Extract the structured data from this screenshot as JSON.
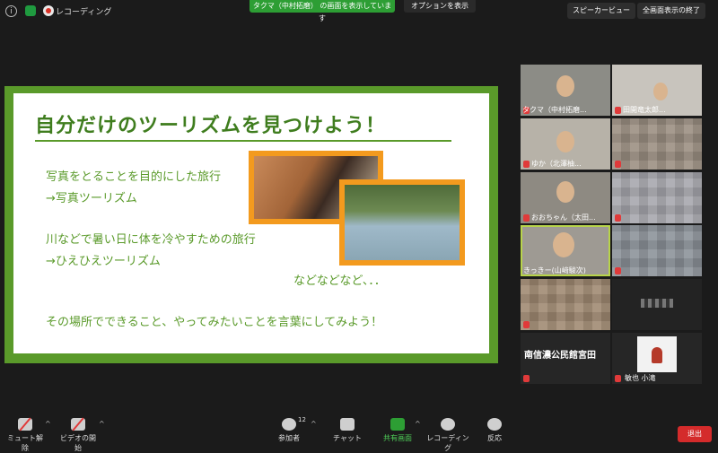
{
  "topbar": {
    "recording_label": "レコーディング",
    "share_banner": "タクマ（中村拓磨） の画面を表示しています",
    "options_label": "オプションを表示",
    "speaker_view_label": "スピーカービュー",
    "exit_fullscreen_label": "全画面表示の終了"
  },
  "slide": {
    "title": "自分だけのツーリズムを見つけよう！",
    "lines": [
      "写真をとることを目的にした旅行",
      "→写真ツーリズム",
      "川などで暑い日に体を冷やすための旅行",
      "→ひえひえツーリズム",
      "などなどなど、．．",
      "その場所でできること、やってみたいことを言葉にしてみよう！"
    ]
  },
  "gallery": {
    "tiles": [
      {
        "name": "タクマ（中村拓磨..."
      },
      {
        "name": "田開竜太郎..."
      },
      {
        "name": "ゆか（北澤柚..."
      },
      {
        "name": ""
      },
      {
        "name": "おおちゃん（太田..."
      },
      {
        "name": ""
      },
      {
        "name": "きっきー(山﨑駿次)"
      },
      {
        "name": ""
      },
      {
        "name": ""
      },
      {
        "name": ""
      },
      {
        "name": "南信濃公民館宮田"
      },
      {
        "name": "敏也 小滝"
      }
    ]
  },
  "toolbar": {
    "mute_label": "ミュート解除",
    "video_label": "ビデオの開始",
    "participants_label": "参加者",
    "participants_count": "12",
    "chat_label": "チャット",
    "share_label": "共有画面",
    "record_label": "レコーディング",
    "reactions_label": "反応",
    "end_label": "退出"
  },
  "colors": {
    "accent_green": "#2d9e34",
    "slide_green": "#5a9a2a",
    "photo_orange": "#f39a1e",
    "end_red": "#d42b2b"
  }
}
